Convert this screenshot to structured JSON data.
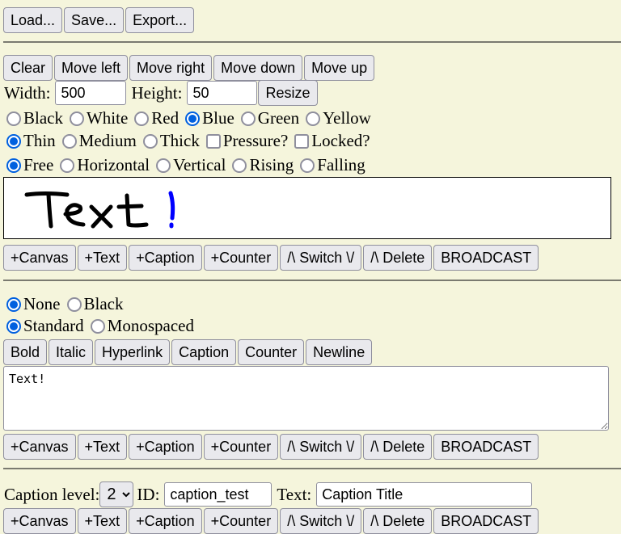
{
  "file": {
    "load": "Load...",
    "save": "Save...",
    "export": "Export..."
  },
  "canvas_block": {
    "actions": {
      "clear": "Clear",
      "move_left": "Move left",
      "move_right": "Move right",
      "move_down": "Move down",
      "move_up": "Move up"
    },
    "width_label": "Width:",
    "width_value": "500",
    "height_label": "Height:",
    "height_value": "50",
    "resize": "Resize",
    "colors": [
      "Black",
      "White",
      "Red",
      "Blue",
      "Green",
      "Yellow"
    ],
    "selected_color": "Blue",
    "thickness": [
      "Thin",
      "Medium",
      "Thick"
    ],
    "selected_thickness": "Thin",
    "pressure_label": "Pressure?",
    "pressure_checked": false,
    "locked_label": "Locked?",
    "locked_checked": false,
    "directions": [
      "Free",
      "Horizontal",
      "Vertical",
      "Rising",
      "Falling"
    ],
    "selected_direction": "Free",
    "drawing_text": "Text!"
  },
  "block_actions": {
    "add_canvas": "+Canvas",
    "add_text": "+Text",
    "add_caption": "+Caption",
    "add_counter": "+Counter",
    "switch": "/\\ Switch \\/",
    "delete": "/\\ Delete",
    "broadcast": "BROADCAST"
  },
  "text_block": {
    "border_options": [
      "None",
      "Black"
    ],
    "selected_border": "None",
    "font_options": [
      "Standard",
      "Monospaced"
    ],
    "selected_font": "Standard",
    "format": {
      "bold": "Bold",
      "italic": "Italic",
      "hyperlink": "Hyperlink",
      "caption": "Caption",
      "counter": "Counter",
      "newline": "Newline"
    },
    "content": "Text!"
  },
  "caption_block": {
    "level_label": "Caption level:",
    "level_value": "2",
    "id_label": "ID:",
    "id_value": "caption_test",
    "text_label": "Text:",
    "text_value": "Caption Title"
  },
  "colors": {
    "background": "#f5f5dc",
    "accent": "#0060df",
    "pen_blue": "#0000ff"
  }
}
